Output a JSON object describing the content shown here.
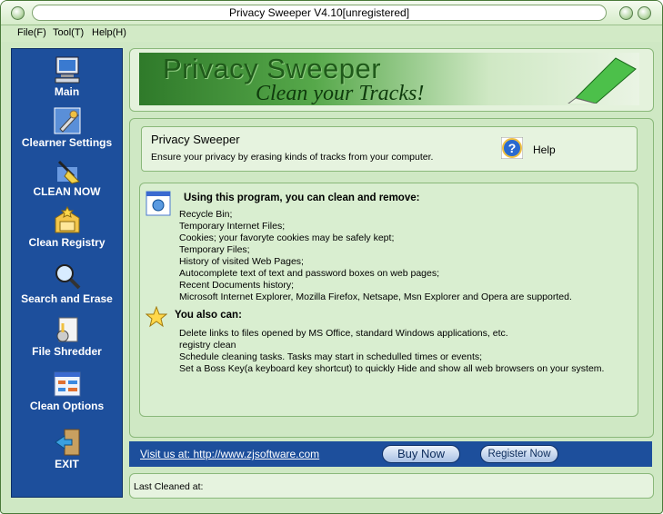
{
  "window": {
    "title": "Privacy Sweeper V4.10[unregistered]"
  },
  "menu": {
    "file": "File(F)",
    "tool": "Tool(T)",
    "help": "Help(H)"
  },
  "sidebar": {
    "items": [
      {
        "label": "Main",
        "icon": "computer-icon"
      },
      {
        "label": "Clearner Settings",
        "icon": "wrench-settings-icon"
      },
      {
        "label": "CLEAN NOW",
        "icon": "broom-icon"
      },
      {
        "label": "Clean Registry",
        "icon": "registry-icon"
      },
      {
        "label": "Search and  Erase",
        "icon": "magnifier-icon"
      },
      {
        "label": "File Shredder",
        "icon": "shredder-icon"
      },
      {
        "label": "Clean Options",
        "icon": "options-icon"
      },
      {
        "label": "EXIT",
        "icon": "exit-door-icon"
      }
    ]
  },
  "banner": {
    "title": "Privacy Sweeper",
    "subtitle": "Clean your Tracks!"
  },
  "info": {
    "title": "Privacy Sweeper",
    "description": "Ensure your privacy by erasing kinds of tracks from your computer.",
    "help_label": "Help"
  },
  "content": {
    "heading1": "Using this program, you can clean and remove:",
    "items1": [
      "Recycle Bin;",
      "Temporary Internet Files;",
      "Cookies; your favoryte cookies may be safely kept;",
      "Temporary Files;",
      "History of visited Web Pages;",
      "Autocomplete text of text and password boxes on web pages;",
      "Recent Documents history;",
      "Microsoft Internet Explorer, Mozilla Firefox, Netsape, Msn Explorer and Opera are supported."
    ],
    "heading2": "You also can:",
    "items2": [
      "Delete links to files opened by MS Office, standard Windows applications, etc.",
      "registry clean",
      "Schedule cleaning tasks. Tasks may start in schedulled times or events;",
      "Set a Boss Key(a keyboard key shortcut) to quickly Hide and show all web browsers on your system."
    ]
  },
  "footer": {
    "link_text": "Visit us at: http://www.zjsoftware.com",
    "buy_label": "Buy Now",
    "register_label": "Register Now"
  },
  "status": {
    "last_cleaned": "Last Cleaned at:"
  },
  "colors": {
    "sidebar": "#1d4f9c",
    "panel": "#cfe8c4",
    "banner_green": "#2f7a2a"
  }
}
